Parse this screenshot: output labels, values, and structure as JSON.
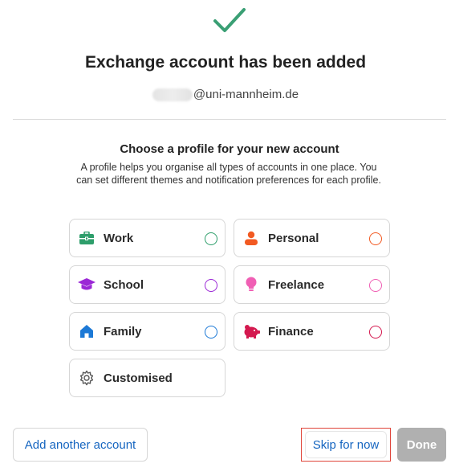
{
  "header": {
    "title": "Exchange account has been added",
    "email_domain": "@uni-mannheim.de"
  },
  "profile_section": {
    "heading": "Choose a profile for your new account",
    "description": "A profile helps you organise all types of accounts in one place. You can set different themes and notification preferences for each profile."
  },
  "profiles": [
    {
      "label": "Work",
      "icon": "briefcase-icon",
      "color": "#2e9e6b"
    },
    {
      "label": "Personal",
      "icon": "person-icon",
      "color": "#f25a22"
    },
    {
      "label": "School",
      "icon": "graduation-cap-icon",
      "color": "#9b27d6"
    },
    {
      "label": "Freelance",
      "icon": "lightbulb-icon",
      "color": "#f05fb4"
    },
    {
      "label": "Family",
      "icon": "house-icon",
      "color": "#1c79d6"
    },
    {
      "label": "Finance",
      "icon": "piggy-bank-icon",
      "color": "#d4194f"
    },
    {
      "label": "Customised",
      "icon": "gear-icon",
      "color": "#666666"
    }
  ],
  "footer": {
    "add_label": "Add another account",
    "skip_label": "Skip for now",
    "done_label": "Done"
  },
  "colors": {
    "success": "#3a9f74",
    "link": "#1565c0",
    "disabled": "#b0b0b0"
  }
}
